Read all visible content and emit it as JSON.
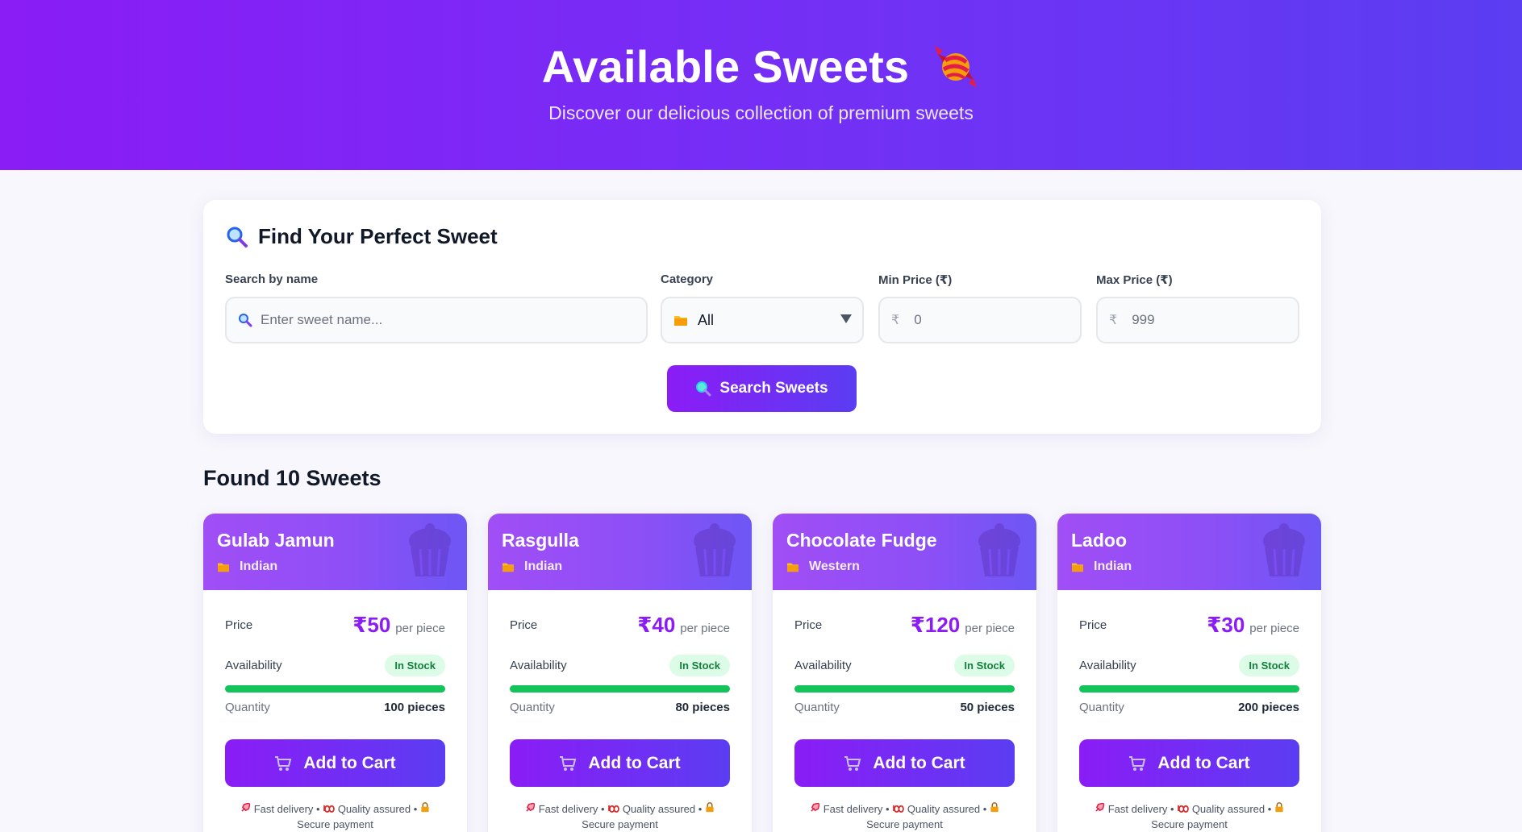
{
  "hero": {
    "title": "Available Sweets",
    "subtitle": "Discover our delicious collection of premium sweets"
  },
  "search_panel": {
    "title": "Find Your Perfect Sweet",
    "name_label": "Search by name",
    "name_placeholder": "Enter sweet name...",
    "category_label": "Category",
    "category_value": "All",
    "min_price_label": "Min Price (₹)",
    "min_price_placeholder": "0",
    "max_price_label": "Max Price (₹)",
    "max_price_placeholder": "999",
    "currency_symbol": "₹",
    "search_button": "Search Sweets"
  },
  "results": {
    "heading": "Found 10 Sweets"
  },
  "labels": {
    "price": "Price",
    "per_piece": "per piece",
    "availability": "Availability",
    "quantity": "Quantity",
    "add_to_cart": "Add to Cart",
    "perks_line1": "Fast delivery •",
    "perks_line1b": "Quality assured •",
    "perks_line2": "Secure payment"
  },
  "sweets": [
    {
      "name": "Gulab Jamun",
      "category": "Indian",
      "price": "₹50",
      "status": "In Stock",
      "quantity": "100 pieces",
      "stock_fraction": 1.0
    },
    {
      "name": "Rasgulla",
      "category": "Indian",
      "price": "₹40",
      "status": "In Stock",
      "quantity": "80 pieces",
      "stock_fraction": 1.0
    },
    {
      "name": "Chocolate Fudge",
      "category": "Western",
      "price": "₹120",
      "status": "In Stock",
      "quantity": "50 pieces",
      "stock_fraction": 1.0
    },
    {
      "name": "Ladoo",
      "category": "Indian",
      "price": "₹30",
      "status": "In Stock",
      "quantity": "200 pieces",
      "stock_fraction": 1.0
    }
  ],
  "colors": {
    "accent": "#8b1cf6",
    "accent_end": "#5b3df2",
    "in_stock": "#14c35a"
  }
}
